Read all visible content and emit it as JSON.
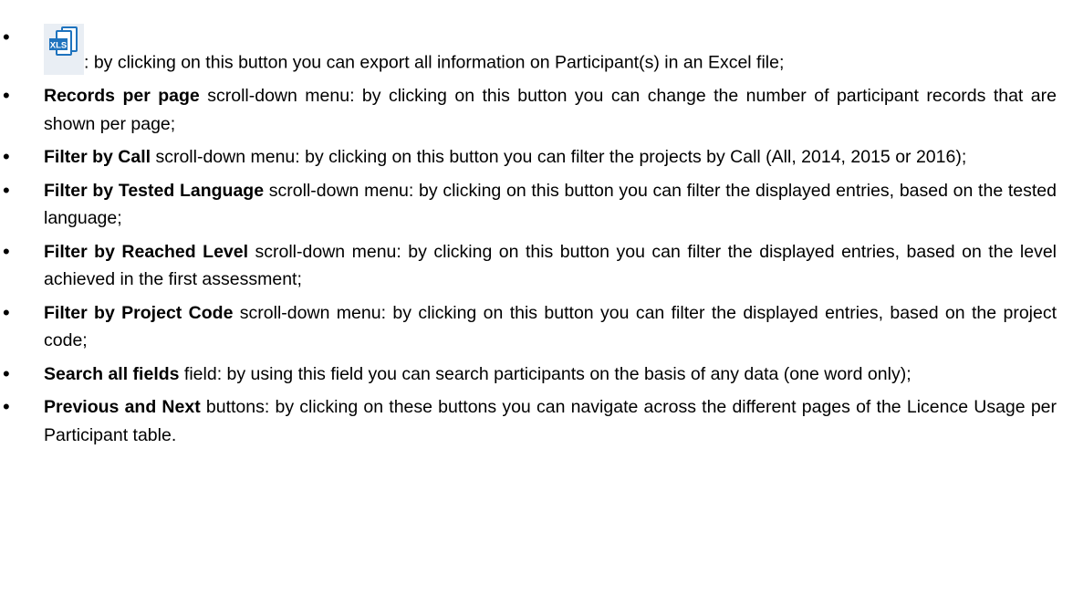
{
  "items": [
    {
      "bullet": "•",
      "icon": "xls-export-icon",
      "term": "",
      "rest": ": by clicking on this button you can export all information on Participant(s) in an Excel file;"
    },
    {
      "bullet": "•",
      "term": "Records per page",
      "rest": " scroll-down menu: by clicking on this button you can change the number of participant records that are shown per page;"
    },
    {
      "bullet": "•",
      "term": "Filter by Call",
      "rest": " scroll-down menu: by clicking on this button you can filter the projects by Call (All, 2014, 2015 or 2016);"
    },
    {
      "bullet": "•",
      "term": "Filter by Tested Language",
      "rest": " scroll-down menu: by clicking on this button you can filter the displayed entries, based on the tested language;"
    },
    {
      "bullet": "•",
      "term": "Filter by Reached Level",
      "rest": " scroll-down menu: by clicking on this button you can filter the displayed entries, based on the level achieved in the first assessment;"
    },
    {
      "bullet": "•",
      "term": "Filter by Project Code",
      "rest": " scroll-down menu: by clicking on this button you can filter the displayed entries, based on the project code;"
    },
    {
      "bullet": "•",
      "term": "Search all fields",
      "rest": " field: by using this field you can search participants on the basis of any data (one word only);"
    },
    {
      "bullet": "•",
      "term": "Previous and Next",
      "rest": " buttons: by clicking on these buttons you can navigate across the different pages of the Licence Usage per Participant table."
    }
  ],
  "icon_label": "XLS",
  "colors": {
    "icon_blue": "#1e73be",
    "icon_bg": "#e9eef4",
    "text": "#000000"
  }
}
